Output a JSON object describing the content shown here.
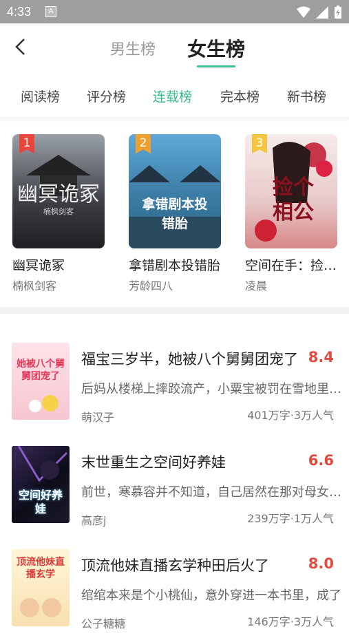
{
  "status": {
    "time": "4:33",
    "notif_icon": "A"
  },
  "header": {
    "tabs": [
      "男生榜",
      "女生榜"
    ],
    "active_tab": 1
  },
  "rank_tabs": [
    "阅读榜",
    "评分榜",
    "连载榜",
    "完本榜",
    "新书榜"
  ],
  "active_rank_tab": 2,
  "top3": [
    {
      "rank": "1",
      "title": "幽冥诡冢",
      "author": "楠枫剑客",
      "cover_text": "幽冥诡冢",
      "cover_sub": "楠枫剑客",
      "badge_color": "#e8453c"
    },
    {
      "rank": "2",
      "title": "拿错剧本投错胎",
      "author": "芳龄四八",
      "cover_text": "拿错剧本投错胎",
      "badge_color": "#f0a030"
    },
    {
      "rank": "3",
      "title": "空间在手：捡个相公来种田",
      "author": "凌晨",
      "cover_text": "捡个相公",
      "badge_color": "#f4c640"
    }
  ],
  "books": [
    {
      "title": "福宝三岁半，她被八个舅舅团宠了",
      "score": "8.4",
      "desc": "后妈从楼梯上摔跤流产，小粟宝被罚在雪地里跪着",
      "author": "萌汉子",
      "meta": "401万字·3万人气",
      "cover_text": "她被八个舅舅团宠了"
    },
    {
      "title": "末世重生之空间好养娃",
      "score": "6.6",
      "desc": "前世，寒慕容并不知道，自己居然在那对母女手中",
      "author": "高彦j",
      "meta": "239万字·1万人气",
      "cover_text": "空间好养娃"
    },
    {
      "title": "顶流他妹直播玄学种田后火了",
      "score": "8.0",
      "desc": "绾绾本来是个小桃仙，意外穿进一本书里，成了",
      "author": "公子糖糖",
      "meta": "146万字·3万人气",
      "cover_text": "顶流他妹直播玄学"
    }
  ]
}
